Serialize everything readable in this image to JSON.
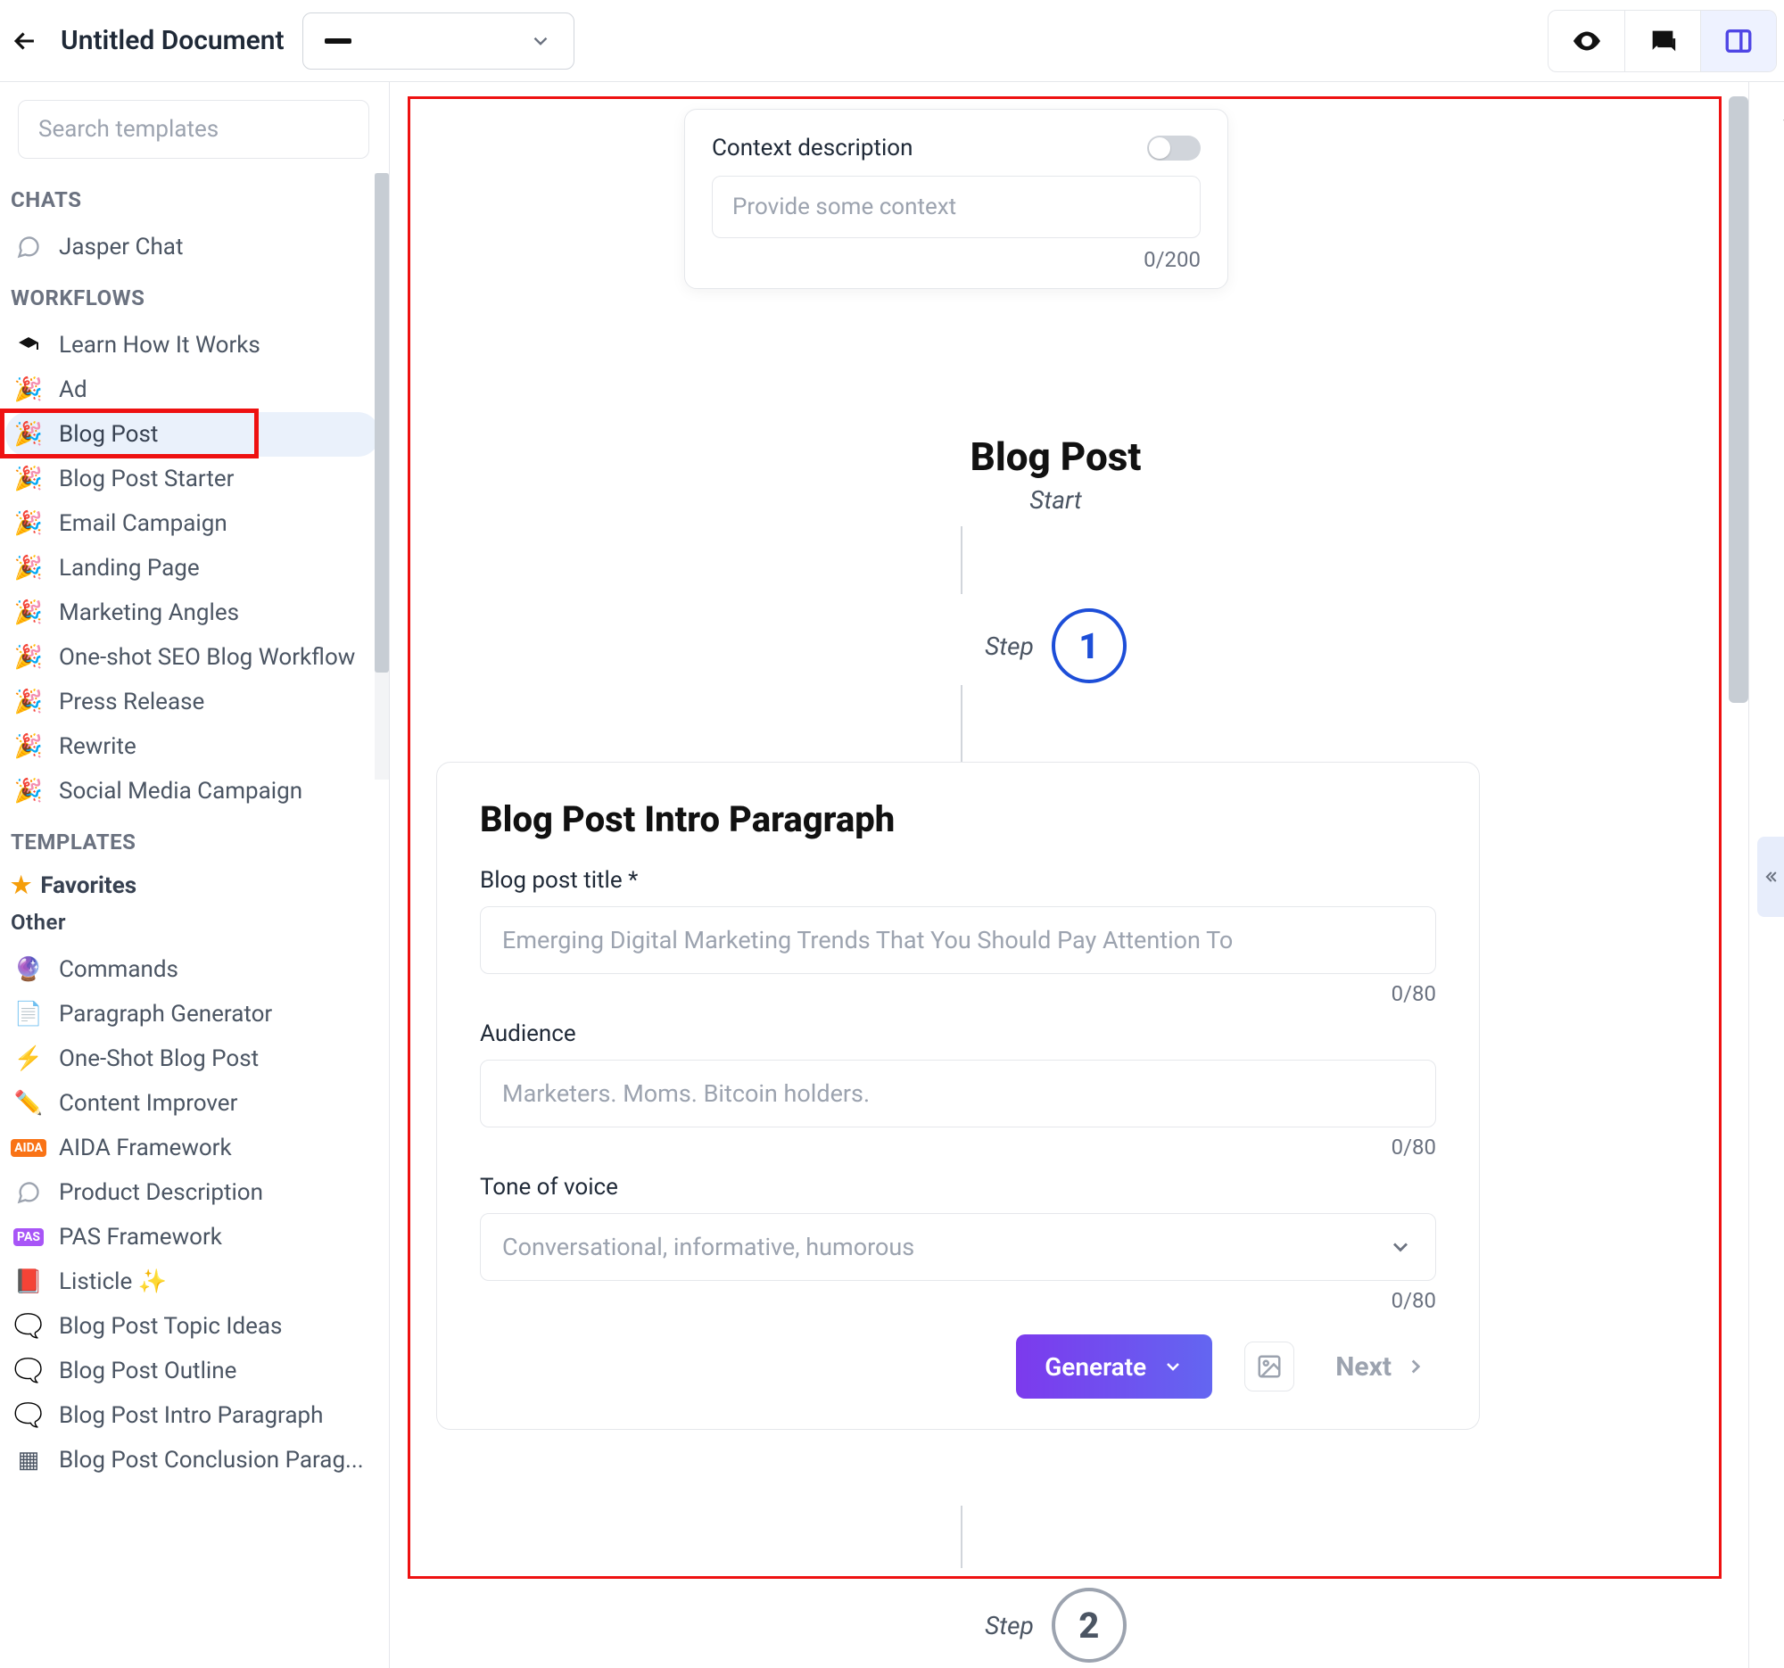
{
  "header": {
    "document_title": "Untitled Document"
  },
  "sidebar": {
    "search_placeholder": "Search templates",
    "sections": {
      "chats_label": "CHATS",
      "workflows_label": "WORKFLOWS",
      "templates_label": "TEMPLATES",
      "favorites_label": "Favorites",
      "other_label": "Other"
    },
    "chats": [
      {
        "label": "Jasper Chat"
      }
    ],
    "workflows": [
      {
        "label": "Learn How It Works"
      },
      {
        "label": "Ad"
      },
      {
        "label": "Blog Post",
        "active": true
      },
      {
        "label": "Blog Post Starter"
      },
      {
        "label": "Email Campaign"
      },
      {
        "label": "Landing Page"
      },
      {
        "label": "Marketing Angles"
      },
      {
        "label": "One-shot SEO Blog Workflow"
      },
      {
        "label": "Press Release"
      },
      {
        "label": "Rewrite"
      },
      {
        "label": "Social Media Campaign"
      }
    ],
    "templates": [
      {
        "label": "Commands"
      },
      {
        "label": "Paragraph Generator"
      },
      {
        "label": "One-Shot Blog Post"
      },
      {
        "label": "Content Improver"
      },
      {
        "label": "AIDA Framework"
      },
      {
        "label": "Product Description"
      },
      {
        "label": "PAS Framework"
      },
      {
        "label": "Listicle ✨"
      },
      {
        "label": "Blog Post Topic Ideas"
      },
      {
        "label": "Blog Post Outline"
      },
      {
        "label": "Blog Post Intro Paragraph"
      },
      {
        "label": "Blog Post Conclusion Parag..."
      }
    ]
  },
  "context_card": {
    "label": "Context description",
    "placeholder": "Provide some context",
    "counter": "0/200"
  },
  "flow": {
    "title": "Blog Post",
    "subtitle": "Start",
    "step_label": "Step",
    "step1_num": "1",
    "step2_num": "2"
  },
  "form": {
    "heading": "Blog Post Intro Paragraph",
    "title_label": "Blog post title *",
    "title_placeholder": "Emerging Digital Marketing Trends That You Should Pay Attention To",
    "title_counter": "0/80",
    "audience_label": "Audience",
    "audience_placeholder": "Marketers. Moms. Bitcoin holders.",
    "audience_counter": "0/80",
    "tone_label": "Tone of voice",
    "tone_placeholder": "Conversational, informative, humorous",
    "tone_counter": "0/80",
    "generate_label": "Generate",
    "next_label": "Next"
  }
}
